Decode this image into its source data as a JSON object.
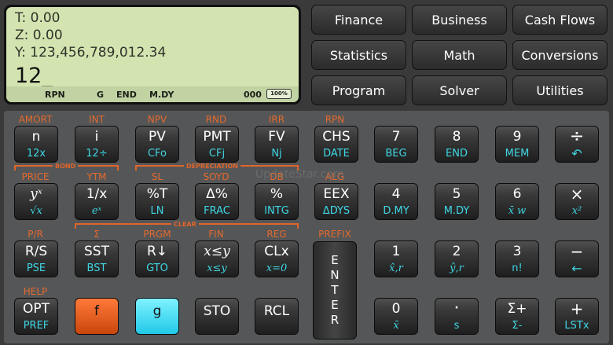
{
  "display": {
    "t": "T:  0.00",
    "z": "Z:  0.00",
    "y": "Y:  123,456,789,012.34",
    "x": "12_",
    "status": {
      "mode": "RPN",
      "g": "G",
      "end": "END",
      "date": "M.DY",
      "memory": "000",
      "battery": "100%"
    }
  },
  "menu": [
    "Finance",
    "Business",
    "Cash Flows",
    "Statistics",
    "Math",
    "Conversions",
    "Program",
    "Solver",
    "Utilities"
  ],
  "f_labels": {
    "amort": "AMORT",
    "int": "INT",
    "npv": "NPV",
    "rnd": "RND",
    "irr": "IRR",
    "rpn": "RPN",
    "price": "PRICE",
    "ytm": "YTM",
    "sl": "SL",
    "soyd": "SOYD",
    "db": "DB",
    "alg": "ALG",
    "pr": "P/R",
    "sigma": "Σ",
    "prgm": "PRGM",
    "fin": "FIN",
    "reg": "REG",
    "prefix": "PREFIX",
    "help": "HELP"
  },
  "groups": {
    "bond": "BOND",
    "depreciation": "DEPRECIATION",
    "clear": "CLEAR"
  },
  "keys": {
    "n": {
      "main": "n",
      "g": "12x"
    },
    "i": {
      "main": "i",
      "g": "12÷"
    },
    "pv": {
      "main": "PV",
      "g": "CFo"
    },
    "pmt": {
      "main": "PMT",
      "g": "CFj"
    },
    "fv": {
      "main": "FV",
      "g": "Nj"
    },
    "chs": {
      "main": "CHS",
      "g": "DATE"
    },
    "k7": {
      "main": "7",
      "g": "BEG"
    },
    "k8": {
      "main": "8",
      "g": "END"
    },
    "k9": {
      "main": "9",
      "g": "MEM"
    },
    "div": {
      "main": "÷",
      "g": "↶"
    },
    "yx": {
      "main": "yˣ",
      "g": "√x"
    },
    "inv": {
      "main": "1/x",
      "g": "eˣ"
    },
    "pct_t": {
      "main": "%T",
      "g": "LN"
    },
    "dpct": {
      "main": "Δ%",
      "g": "FRAC"
    },
    "pct": {
      "main": "%",
      "g": "INTG"
    },
    "eex": {
      "main": "EEX",
      "g": "ΔDYS"
    },
    "k4": {
      "main": "4",
      "g": "D.MY"
    },
    "k5": {
      "main": "5",
      "g": "M.DY"
    },
    "k6": {
      "main": "6",
      "g": "x̄ w"
    },
    "mul": {
      "main": "×",
      "g": "x²"
    },
    "rs": {
      "main": "R/S",
      "g": "PSE"
    },
    "sst": {
      "main": "SST",
      "g": "BST"
    },
    "rdown": {
      "main": "R↓",
      "g": "GTO"
    },
    "xy": {
      "main": "x≤y",
      "g": "x≤y"
    },
    "clx": {
      "main": "CLx",
      "g": "x=0"
    },
    "enter": {
      "main": "ENTER"
    },
    "k1": {
      "main": "1",
      "g": "x̂,r"
    },
    "k2": {
      "main": "2",
      "g": "ŷ,r"
    },
    "k3": {
      "main": "3",
      "g": "n!"
    },
    "sub": {
      "main": "−",
      "g": "←"
    },
    "opt": {
      "main": "OPT",
      "g": "PREF"
    },
    "f": {
      "main": "f"
    },
    "g": {
      "main": "g"
    },
    "sto": {
      "main": "STO"
    },
    "rcl": {
      "main": "RCL"
    },
    "k0": {
      "main": "0",
      "g": "x̄"
    },
    "dot": {
      "main": "·",
      "g": "s"
    },
    "sigma_plus": {
      "main": "Σ+",
      "g": "Σ-"
    },
    "add": {
      "main": "+",
      "g": "LSTx"
    }
  },
  "watermark": "UpdateStar.com",
  "colors": {
    "f_orange": "#e0652b",
    "g_cyan": "#3fd6e4",
    "lcd": "#d3e4b1"
  }
}
